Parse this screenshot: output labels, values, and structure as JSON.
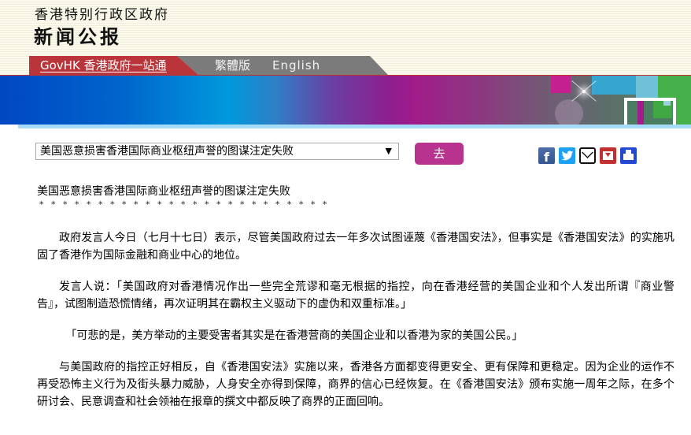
{
  "header": {
    "org_name": "香港特别行政区政府",
    "section_title": "新闻公报",
    "nav": {
      "govhk_label": "GovHK 香港政府一站通",
      "traditional_label": "繁體版",
      "english_label": "English"
    }
  },
  "toolbar": {
    "selected_article": "美国恶意损害香港国际商业枢纽声誉的图谋注定失败",
    "select_arrow": "▼",
    "go_label": "去",
    "share": [
      {
        "name": "facebook",
        "glyph": "f"
      },
      {
        "name": "twitter",
        "glyph": ""
      },
      {
        "name": "email",
        "glyph": ""
      },
      {
        "name": "save",
        "glyph": ""
      },
      {
        "name": "print",
        "glyph": ""
      }
    ]
  },
  "article": {
    "title": "美国恶意损害香港国际商业枢纽声誉的图谋注定失败",
    "separator": "* * * * * * * * * * * * * * * * * * * * * * * * *",
    "paragraphs": [
      "政府发言人今日（七月十七日）表示，尽管美国政府过去一年多次试图诬蔑《香港国安法》，但事实是《香港国安法》的实施巩固了香港作为国际金融和商业中心的地位。",
      "发言人说：「美国政府对香港情况作出一些完全荒谬和毫无根据的指控，向在香港经营的美国企业和个人发出所谓『商业警告』，试图制造恐慌情绪，再次证明其在霸权主义驱动下的虚伪和双重标准。」",
      "「可悲的是，美方举动的主要受害者其实是在香港营商的美国企业和以香港为家的美国公民。」",
      "与美国政府的指控正好相反，自《香港国安法》实施以来，香港各方面都变得更安全、更有保障和更稳定。因为企业的运作不再受恐怖主义行为及街头暴力威胁，人身安全亦得到保障，商界的信心已经恢复。在《香港国安法》颁布实施一周年之际，在多个研讨会、民意调查和社会领袖在报章的撰文中都反映了商界的正面回响。"
    ]
  }
}
